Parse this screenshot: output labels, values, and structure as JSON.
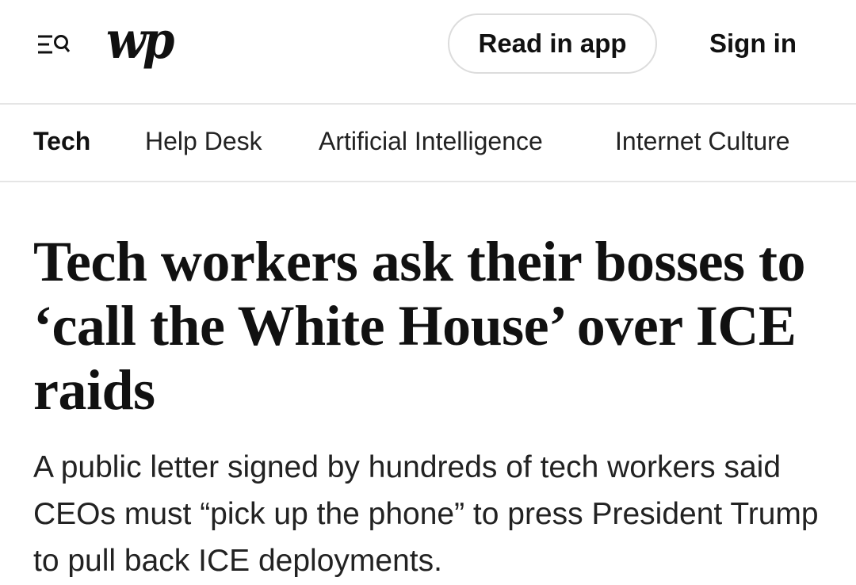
{
  "header": {
    "menu_icon": "menu-search-icon",
    "logo_text": "wp",
    "read_in_app_label": "Read in app",
    "sign_in_label": "Sign in"
  },
  "subnav": {
    "items": [
      {
        "label": "Tech",
        "active": true
      },
      {
        "label": "Help Desk",
        "active": false
      },
      {
        "label": "Artificial Intelligence",
        "active": false
      },
      {
        "label": "Internet Culture",
        "active": false
      }
    ]
  },
  "article": {
    "headline": "Tech workers ask their bosses to ‘call the White House’ over ICE raids",
    "dek": "A public letter signed by hundreds of tech workers said CEOs must “pick up the phone” to press President Trump to pull back ICE deployments."
  },
  "colors": {
    "text": "#111111",
    "divider": "#e5e5e5",
    "button_border": "#dcdcdc"
  }
}
